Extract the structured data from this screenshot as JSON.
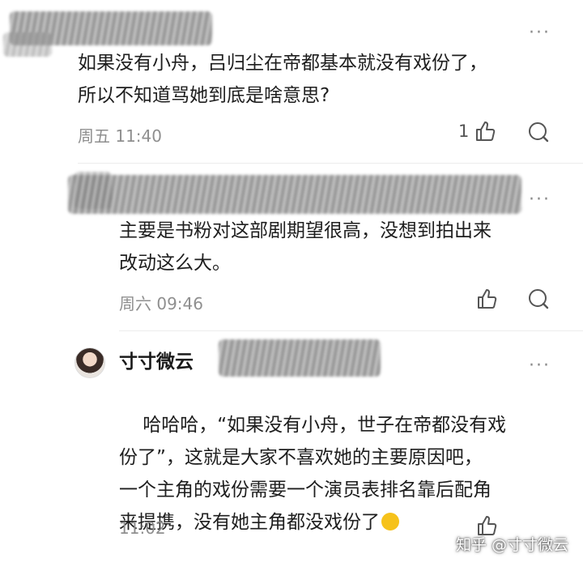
{
  "comments": [
    {
      "text": "如果没有小舟，吕归尘在帝都基本就没有戏份了，\n所以不知道骂她到底是啥意思?",
      "time": "周五 11:40",
      "likes": "1",
      "more": "···"
    },
    {
      "text": "主要是书粉对这部剧期望很高，没想到拍出来\n改动这么大。",
      "time": "周六 09:46",
      "more": "···"
    },
    {
      "username": "寸寸微云",
      "text": "哈哈哈，“如果没有小舟，世子在帝都没有戏\n份了”，这就是大家不喜欢她的主要原因吧，\n一个主角的戏份需要一个演员表排名靠后配角\n来提携，没有她主角都没戏份了",
      "emoji": "laughing-crying",
      "time": "11:02",
      "more": "···"
    }
  ],
  "watermark": "知乎 @寸寸微云"
}
